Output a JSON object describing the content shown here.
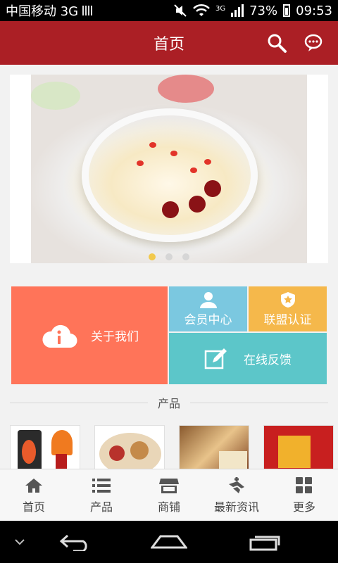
{
  "status_bar": {
    "carrier": "中国移动 3G",
    "network": "3G",
    "battery": "73%",
    "time": "09:53"
  },
  "header": {
    "title": "首页",
    "search_icon": "search-icon",
    "message_icon": "message-icon"
  },
  "banner": {
    "slide_count": 3,
    "active_slide": 1
  },
  "tiles": {
    "about": "关于我们",
    "member": "会员中心",
    "league": "联盟认证",
    "feedback": "在线反馈"
  },
  "products_section": {
    "title": "产品"
  },
  "bottom_nav": {
    "items": [
      {
        "label": "首页",
        "icon": "home-icon"
      },
      {
        "label": "产品",
        "icon": "list-icon"
      },
      {
        "label": "商铺",
        "icon": "shop-icon"
      },
      {
        "label": "最新资讯",
        "icon": "news-icon"
      },
      {
        "label": "更多",
        "icon": "grid-icon"
      }
    ]
  },
  "colors": {
    "header": "#ab1f25",
    "about_tile": "#ff7459",
    "member_tile": "#7bc8e0",
    "league_tile": "#f5b84b",
    "feedback_tile": "#5cc6c9"
  }
}
